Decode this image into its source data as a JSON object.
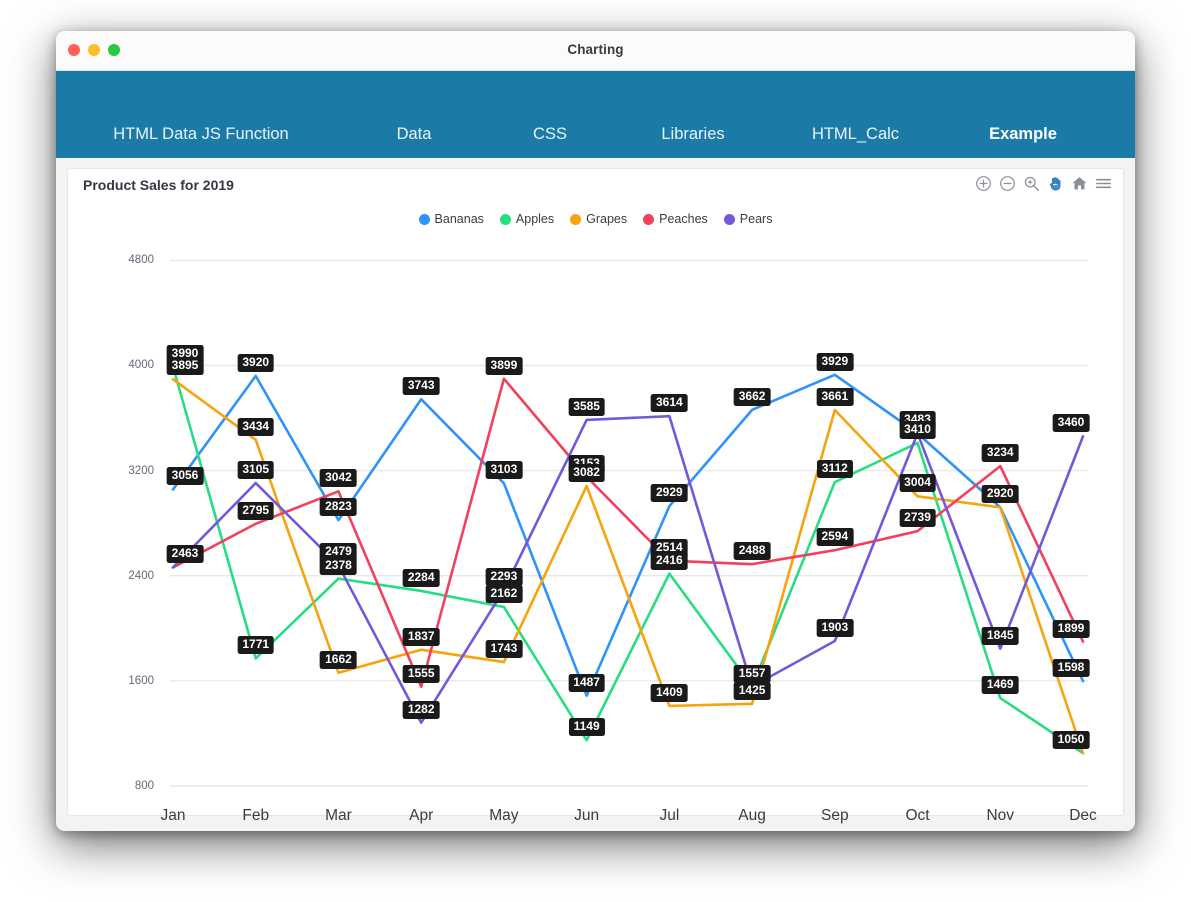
{
  "window": {
    "title": "Charting",
    "traffic_lights": [
      "close",
      "minimize",
      "maximize"
    ]
  },
  "navbar": {
    "items": [
      {
        "label": "HTML Data JS Function",
        "active": false
      },
      {
        "label": "Data",
        "active": false
      },
      {
        "label": "CSS",
        "active": false
      },
      {
        "label": "Libraries",
        "active": false
      },
      {
        "label": "HTML_Calc",
        "active": false
      },
      {
        "label": "Example",
        "active": true
      }
    ],
    "background": "#1b7ba6"
  },
  "toolbar": {
    "icons": [
      "zoom-in-icon",
      "zoom-out-icon",
      "selection-zoom-icon",
      "panning-icon",
      "reset-zoom-icon",
      "menu-icon"
    ]
  },
  "chart_data": {
    "type": "line",
    "title": "Product Sales for 2019",
    "xlabel": "",
    "ylabel": "",
    "categories": [
      "Jan",
      "Feb",
      "Mar",
      "Apr",
      "May",
      "Jun",
      "Jul",
      "Aug",
      "Sep",
      "Oct",
      "Nov",
      "Dec"
    ],
    "yticks": [
      800,
      1600,
      2400,
      3200,
      4000,
      4800
    ],
    "ylim": [
      800,
      5000
    ],
    "grid": true,
    "legend_position": "top",
    "data_labels": true,
    "series": [
      {
        "name": "Bananas",
        "color": "#2e93fa",
        "values": [
          3056,
          3920,
          2823,
          3743,
          3103,
          1487,
          2929,
          3662,
          3929,
          3483,
          2920,
          1598
        ]
      },
      {
        "name": "Apples",
        "color": "#26de81",
        "values": [
          3990,
          1771,
          2378,
          2284,
          2162,
          1149,
          2416,
          1557,
          3112,
          3410,
          1469,
          1050
        ]
      },
      {
        "name": "Grapes",
        "color": "#f7a30e",
        "values": [
          3895,
          3434,
          1662,
          1837,
          1743,
          3082,
          1409,
          1425,
          3661,
          3004,
          2920,
          1050
        ]
      },
      {
        "name": "Peaches",
        "color": "#f2405d",
        "values": [
          2463,
          2795,
          3042,
          1555,
          3899,
          3153,
          2514,
          2488,
          2594,
          2739,
          3234,
          1899
        ]
      },
      {
        "name": "Pears",
        "color": "#7558d9",
        "values": [
          2463,
          3105,
          2479,
          1282,
          2293,
          3585,
          3614,
          1557,
          1903,
          3483,
          1845,
          3460
        ]
      }
    ],
    "visible_labels": [
      {
        "text": "3990",
        "month": "Jan",
        "series": "Apples"
      },
      {
        "text": "3895",
        "month": "Jan",
        "series": "Grapes"
      },
      {
        "text": "3056",
        "month": "Jan",
        "series": "Bananas"
      },
      {
        "text": "2463",
        "month": "Jan",
        "series": "Peaches"
      },
      {
        "text": "3920",
        "month": "Feb",
        "series": "Bananas"
      },
      {
        "text": "3434",
        "month": "Feb",
        "series": "Grapes"
      },
      {
        "text": "3105",
        "month": "Feb",
        "series": "Pears"
      },
      {
        "text": "2795",
        "month": "Feb",
        "series": "Peaches"
      },
      {
        "text": "1771",
        "month": "Feb",
        "series": "Apples"
      },
      {
        "text": "3042",
        "month": "Mar",
        "series": "Peaches"
      },
      {
        "text": "2823",
        "month": "Mar",
        "series": "Bananas"
      },
      {
        "text": "2479",
        "month": "Mar",
        "series": "Pears"
      },
      {
        "text": "2378",
        "month": "Mar",
        "series": "Apples"
      },
      {
        "text": "1662",
        "month": "Mar",
        "series": "Grapes"
      },
      {
        "text": "3743",
        "month": "Apr",
        "series": "Bananas"
      },
      {
        "text": "2284",
        "month": "Apr",
        "series": "Apples"
      },
      {
        "text": "1837",
        "month": "Apr",
        "series": "Grapes"
      },
      {
        "text": "1555",
        "month": "Apr",
        "series": "Peaches"
      },
      {
        "text": "1282",
        "month": "Apr",
        "series": "Pears"
      },
      {
        "text": "3899",
        "month": "May",
        "series": "Peaches"
      },
      {
        "text": "3103",
        "month": "May",
        "series": "Bananas"
      },
      {
        "text": "2293",
        "month": "May",
        "series": "Pears"
      },
      {
        "text": "2162",
        "month": "May",
        "series": "Apples"
      },
      {
        "text": "1743",
        "month": "May",
        "series": "Grapes"
      },
      {
        "text": "3585",
        "month": "Jun",
        "series": "Pears"
      },
      {
        "text": "3153",
        "month": "Jun",
        "series": "Peaches"
      },
      {
        "text": "3082",
        "month": "Jun",
        "series": "Grapes"
      },
      {
        "text": "1487",
        "month": "Jun",
        "series": "Bananas"
      },
      {
        "text": "1149",
        "month": "Jun",
        "series": "Apples"
      },
      {
        "text": "3614",
        "month": "Jul",
        "series": "Pears"
      },
      {
        "text": "2929",
        "month": "Jul",
        "series": "Bananas"
      },
      {
        "text": "2514",
        "month": "Jul",
        "series": "Peaches"
      },
      {
        "text": "2416",
        "month": "Jul",
        "series": "Apples"
      },
      {
        "text": "1409",
        "month": "Jul",
        "series": "Grapes"
      },
      {
        "text": "3662",
        "month": "Aug",
        "series": "Bananas"
      },
      {
        "text": "2488",
        "month": "Aug",
        "series": "Peaches"
      },
      {
        "text": "1557",
        "month": "Aug",
        "series": "Apples"
      },
      {
        "text": "1425",
        "month": "Aug",
        "series": "Grapes"
      },
      {
        "text": "3929",
        "month": "Sep",
        "series": "Bananas"
      },
      {
        "text": "3661",
        "month": "Sep",
        "series": "Grapes"
      },
      {
        "text": "3112",
        "month": "Sep",
        "series": "Apples"
      },
      {
        "text": "2594",
        "month": "Sep",
        "series": "Peaches"
      },
      {
        "text": "1903",
        "month": "Sep",
        "series": "Pears"
      },
      {
        "text": "3483",
        "month": "Oct",
        "series": "Pears"
      },
      {
        "text": "3410",
        "month": "Oct",
        "series": "Apples"
      },
      {
        "text": "3004",
        "month": "Oct",
        "series": "Grapes"
      },
      {
        "text": "2739",
        "month": "Oct",
        "series": "Peaches"
      },
      {
        "text": "3234",
        "month": "Nov",
        "series": "Peaches"
      },
      {
        "text": "2920",
        "month": "Nov",
        "series": "Bananas"
      },
      {
        "text": "1845",
        "month": "Nov",
        "series": "Pears"
      },
      {
        "text": "1469",
        "month": "Nov",
        "series": "Apples"
      },
      {
        "text": "3460",
        "month": "Dec",
        "series": "Pears"
      },
      {
        "text": "1899",
        "month": "Dec",
        "series": "Peaches"
      },
      {
        "text": "1598",
        "month": "Dec",
        "series": "Bananas"
      },
      {
        "text": "1050",
        "month": "Dec",
        "series": "Apples"
      }
    ]
  }
}
